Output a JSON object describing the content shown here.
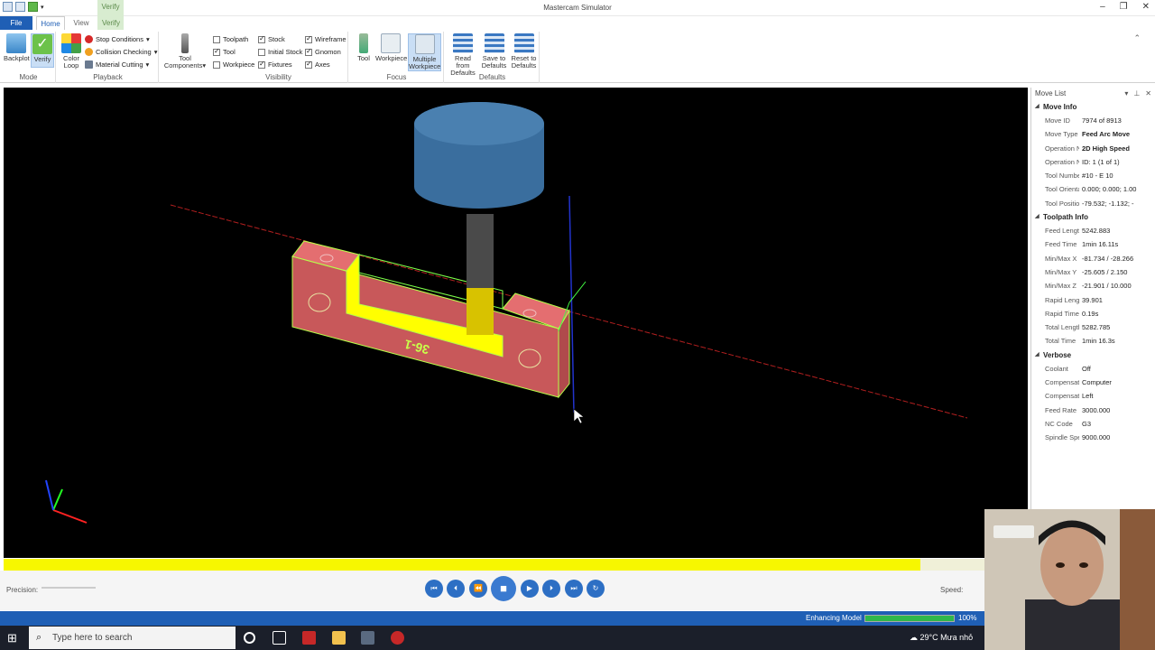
{
  "window": {
    "title": "Mastercam Simulator",
    "context_tab": "Verify"
  },
  "tabs": {
    "file": "File",
    "home": "Home",
    "view": "View",
    "verify": "Verify"
  },
  "ribbon": {
    "mode": {
      "label": "Mode",
      "backplot": "Backplot",
      "verify": "Verify"
    },
    "playback": {
      "label": "Playback",
      "color_loop_1": "Color",
      "color_loop_2": "Loop",
      "stop_conditions": "Stop Conditions",
      "collision_checking": "Collision Checking",
      "material_cutting": "Material Cutting"
    },
    "tool_components": {
      "line1": "Tool",
      "line2": "Components"
    },
    "visibility": {
      "label": "Visibility",
      "toolpath": "Toolpath",
      "tool": "Tool",
      "workpiece": "Workpiece",
      "stock": "Stock",
      "initial_stock": "Initial Stock",
      "fixtures": "Fixtures",
      "wireframe": "Wireframe",
      "gnomon": "Gnomon",
      "axes": "Axes"
    },
    "focus": {
      "label": "Focus",
      "tool": "Tool",
      "workpiece": "Workpiece",
      "multiple_1": "Multiple",
      "multiple_2": "Workpiece"
    },
    "defaults": {
      "label": "Defaults",
      "read_1": "Read from",
      "read_2": "Defaults",
      "save_1": "Save to",
      "save_2": "Defaults",
      "reset_1": "Reset to",
      "reset_2": "Defaults"
    }
  },
  "viewport": {
    "part_label": "36-1"
  },
  "move_list": {
    "title": "Move List",
    "sections": {
      "move_info": "Move Info",
      "toolpath_info": "Toolpath Info",
      "verbose": "Verbose"
    },
    "move_info": [
      {
        "k": "Move ID",
        "v": "7974 of 8913"
      },
      {
        "k": "Move Type",
        "v": "Feed Arc Move"
      },
      {
        "k": "Operation Na",
        "v": "2D High Speed"
      },
      {
        "k": "Operation Nu",
        "v": "ID: 1 (1 of 1)"
      },
      {
        "k": "Tool Number",
        "v": "#10 - E 10"
      },
      {
        "k": "Tool Orientati",
        "v": "0.000; 0.000; 1.00"
      },
      {
        "k": "Tool Position",
        "v": "-79.532; -1.132; -"
      }
    ],
    "toolpath_info": [
      {
        "k": "Feed Length",
        "v": "5242.883"
      },
      {
        "k": "Feed Time",
        "v": "1min 16.11s"
      },
      {
        "k": "Min/Max X",
        "v": "-81.734 / -28.266"
      },
      {
        "k": "Min/Max Y",
        "v": "-25.605 / 2.150"
      },
      {
        "k": "Min/Max Z",
        "v": "-21.901 / 10.000"
      },
      {
        "k": "Rapid Length",
        "v": "39.901"
      },
      {
        "k": "Rapid Time",
        "v": "0.19s"
      },
      {
        "k": "Total Length",
        "v": "5282.785"
      },
      {
        "k": "Total Time",
        "v": "1min 16.3s"
      }
    ],
    "verbose": [
      {
        "k": "Coolant",
        "v": "Off"
      },
      {
        "k": "Compensation",
        "v": "Computer"
      },
      {
        "k": "Compensation",
        "v": "Left"
      },
      {
        "k": "Feed Rate",
        "v": "3000.000"
      },
      {
        "k": "NC Code",
        "v": "G3"
      },
      {
        "k": "Spindle Speed",
        "v": "9000.000"
      }
    ]
  },
  "playback_bar": {
    "progress_fraction": 0.895
  },
  "controls": {
    "precision": "Precision:",
    "speed": "Speed:"
  },
  "status": {
    "label": "Enhancing Model",
    "percent": "100%",
    "fraction": 1.0
  },
  "taskbar": {
    "search_placeholder": "Type here to search",
    "weather": "29°C  Mưa nhỏ"
  },
  "colors": {
    "accent": "#1f5fb5",
    "progress": "#f7f700",
    "stock": "#c8585a",
    "highlight": "#ffff00"
  }
}
